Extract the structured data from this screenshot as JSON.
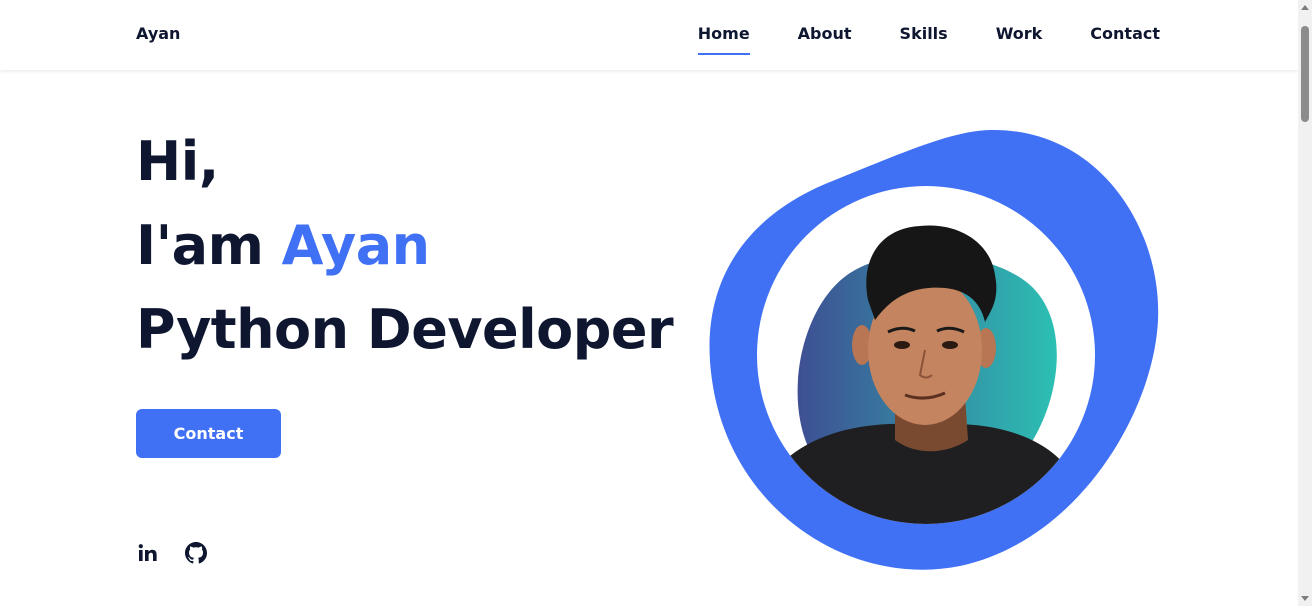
{
  "header": {
    "logo": "Ayan",
    "nav": [
      {
        "label": "Home",
        "active": true
      },
      {
        "label": "About",
        "active": false
      },
      {
        "label": "Skills",
        "active": false
      },
      {
        "label": "Work",
        "active": false
      },
      {
        "label": "Contact",
        "active": false
      }
    ]
  },
  "hero": {
    "line1": "Hi,",
    "line2_prefix": "I'am ",
    "line2_name": "Ayan",
    "line3": "Python Developer",
    "button_label": "Contact"
  },
  "social": [
    {
      "icon": "linkedin-icon",
      "label": "in"
    },
    {
      "icon": "github-icon"
    }
  ],
  "colors": {
    "accent": "#4070f4",
    "text": "#0e1630",
    "gradient_start": "#3e4f93",
    "gradient_end": "#2cc0b3"
  }
}
